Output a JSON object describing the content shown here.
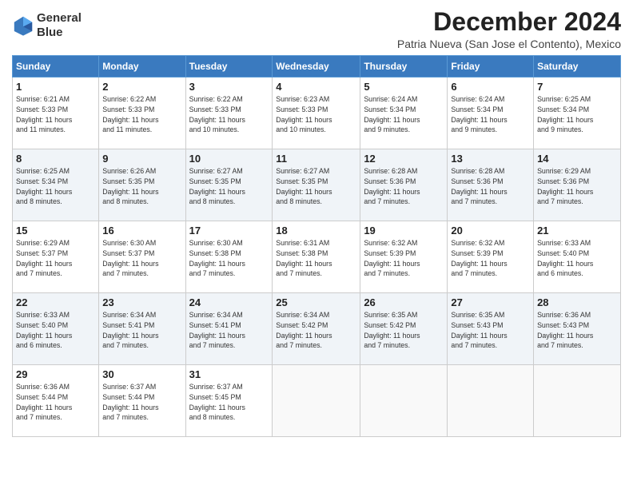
{
  "logo": {
    "line1": "General",
    "line2": "Blue"
  },
  "title": "December 2024",
  "subtitle": "Patria Nueva (San Jose el Contento), Mexico",
  "header_days": [
    "Sunday",
    "Monday",
    "Tuesday",
    "Wednesday",
    "Thursday",
    "Friday",
    "Saturday"
  ],
  "weeks": [
    [
      {
        "day": "1",
        "info": "Sunrise: 6:21 AM\nSunset: 5:33 PM\nDaylight: 11 hours\nand 11 minutes."
      },
      {
        "day": "2",
        "info": "Sunrise: 6:22 AM\nSunset: 5:33 PM\nDaylight: 11 hours\nand 11 minutes."
      },
      {
        "day": "3",
        "info": "Sunrise: 6:22 AM\nSunset: 5:33 PM\nDaylight: 11 hours\nand 10 minutes."
      },
      {
        "day": "4",
        "info": "Sunrise: 6:23 AM\nSunset: 5:33 PM\nDaylight: 11 hours\nand 10 minutes."
      },
      {
        "day": "5",
        "info": "Sunrise: 6:24 AM\nSunset: 5:34 PM\nDaylight: 11 hours\nand 9 minutes."
      },
      {
        "day": "6",
        "info": "Sunrise: 6:24 AM\nSunset: 5:34 PM\nDaylight: 11 hours\nand 9 minutes."
      },
      {
        "day": "7",
        "info": "Sunrise: 6:25 AM\nSunset: 5:34 PM\nDaylight: 11 hours\nand 9 minutes."
      }
    ],
    [
      {
        "day": "8",
        "info": "Sunrise: 6:25 AM\nSunset: 5:34 PM\nDaylight: 11 hours\nand 8 minutes."
      },
      {
        "day": "9",
        "info": "Sunrise: 6:26 AM\nSunset: 5:35 PM\nDaylight: 11 hours\nand 8 minutes."
      },
      {
        "day": "10",
        "info": "Sunrise: 6:27 AM\nSunset: 5:35 PM\nDaylight: 11 hours\nand 8 minutes."
      },
      {
        "day": "11",
        "info": "Sunrise: 6:27 AM\nSunset: 5:35 PM\nDaylight: 11 hours\nand 8 minutes."
      },
      {
        "day": "12",
        "info": "Sunrise: 6:28 AM\nSunset: 5:36 PM\nDaylight: 11 hours\nand 7 minutes."
      },
      {
        "day": "13",
        "info": "Sunrise: 6:28 AM\nSunset: 5:36 PM\nDaylight: 11 hours\nand 7 minutes."
      },
      {
        "day": "14",
        "info": "Sunrise: 6:29 AM\nSunset: 5:36 PM\nDaylight: 11 hours\nand 7 minutes."
      }
    ],
    [
      {
        "day": "15",
        "info": "Sunrise: 6:29 AM\nSunset: 5:37 PM\nDaylight: 11 hours\nand 7 minutes."
      },
      {
        "day": "16",
        "info": "Sunrise: 6:30 AM\nSunset: 5:37 PM\nDaylight: 11 hours\nand 7 minutes."
      },
      {
        "day": "17",
        "info": "Sunrise: 6:30 AM\nSunset: 5:38 PM\nDaylight: 11 hours\nand 7 minutes."
      },
      {
        "day": "18",
        "info": "Sunrise: 6:31 AM\nSunset: 5:38 PM\nDaylight: 11 hours\nand 7 minutes."
      },
      {
        "day": "19",
        "info": "Sunrise: 6:32 AM\nSunset: 5:39 PM\nDaylight: 11 hours\nand 7 minutes."
      },
      {
        "day": "20",
        "info": "Sunrise: 6:32 AM\nSunset: 5:39 PM\nDaylight: 11 hours\nand 7 minutes."
      },
      {
        "day": "21",
        "info": "Sunrise: 6:33 AM\nSunset: 5:40 PM\nDaylight: 11 hours\nand 6 minutes."
      }
    ],
    [
      {
        "day": "22",
        "info": "Sunrise: 6:33 AM\nSunset: 5:40 PM\nDaylight: 11 hours\nand 6 minutes."
      },
      {
        "day": "23",
        "info": "Sunrise: 6:34 AM\nSunset: 5:41 PM\nDaylight: 11 hours\nand 7 minutes."
      },
      {
        "day": "24",
        "info": "Sunrise: 6:34 AM\nSunset: 5:41 PM\nDaylight: 11 hours\nand 7 minutes."
      },
      {
        "day": "25",
        "info": "Sunrise: 6:34 AM\nSunset: 5:42 PM\nDaylight: 11 hours\nand 7 minutes."
      },
      {
        "day": "26",
        "info": "Sunrise: 6:35 AM\nSunset: 5:42 PM\nDaylight: 11 hours\nand 7 minutes."
      },
      {
        "day": "27",
        "info": "Sunrise: 6:35 AM\nSunset: 5:43 PM\nDaylight: 11 hours\nand 7 minutes."
      },
      {
        "day": "28",
        "info": "Sunrise: 6:36 AM\nSunset: 5:43 PM\nDaylight: 11 hours\nand 7 minutes."
      }
    ],
    [
      {
        "day": "29",
        "info": "Sunrise: 6:36 AM\nSunset: 5:44 PM\nDaylight: 11 hours\nand 7 minutes."
      },
      {
        "day": "30",
        "info": "Sunrise: 6:37 AM\nSunset: 5:44 PM\nDaylight: 11 hours\nand 7 minutes."
      },
      {
        "day": "31",
        "info": "Sunrise: 6:37 AM\nSunset: 5:45 PM\nDaylight: 11 hours\nand 8 minutes."
      },
      {
        "day": "",
        "info": ""
      },
      {
        "day": "",
        "info": ""
      },
      {
        "day": "",
        "info": ""
      },
      {
        "day": "",
        "info": ""
      }
    ]
  ]
}
